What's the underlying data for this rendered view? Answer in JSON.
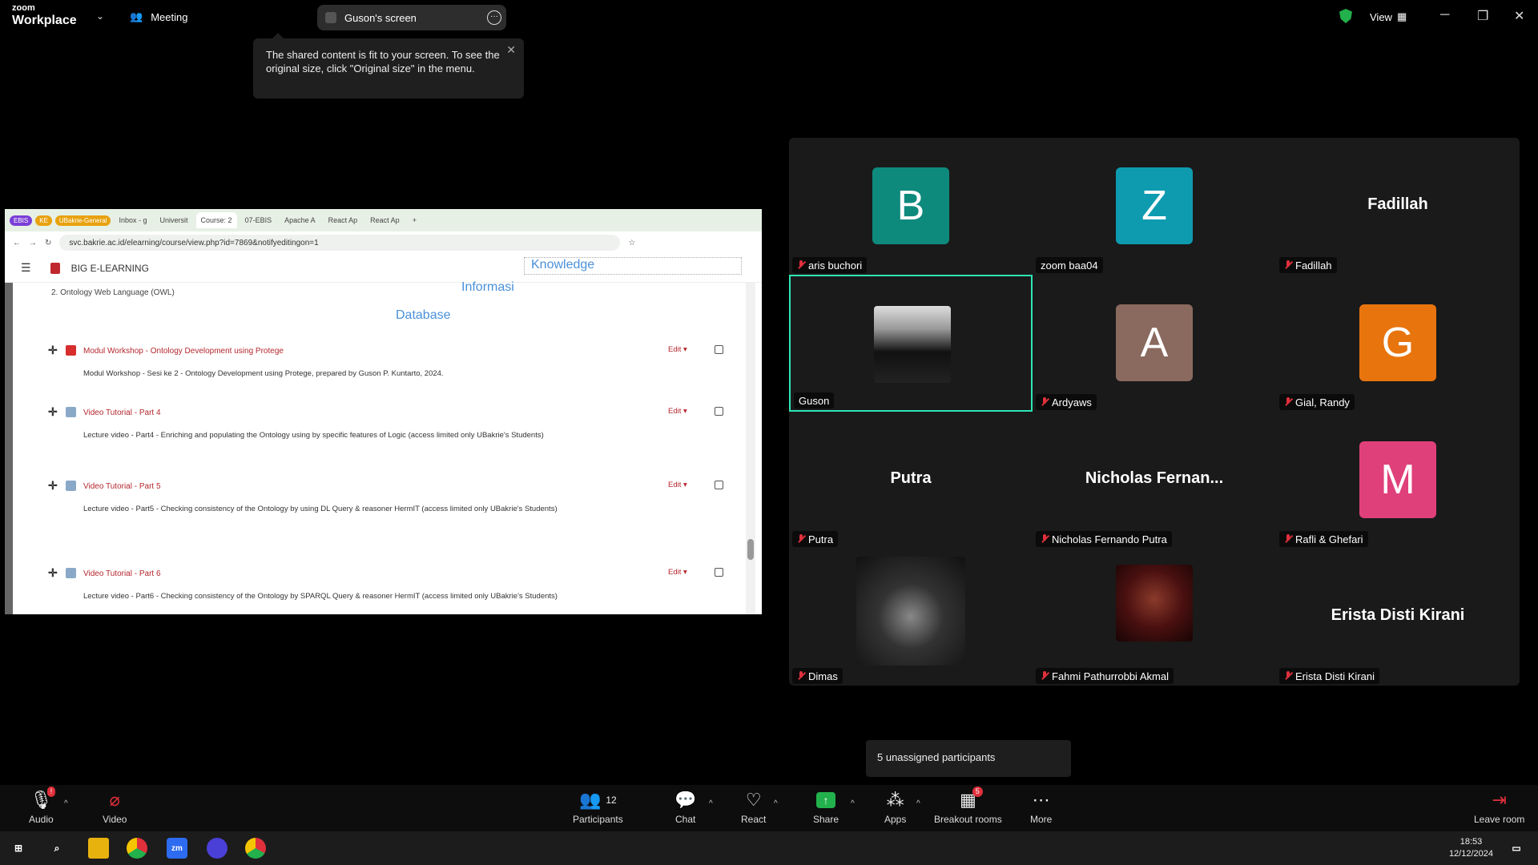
{
  "app": {
    "brand_top": "zoom",
    "brand_bottom": "Workplace",
    "meeting_label": "Meeting",
    "share_pill": "Guson's screen",
    "view_label": "View"
  },
  "tooltip": {
    "text": "The shared content is fit to your screen. To see the original size, click \"Original size\" in the menu."
  },
  "browser": {
    "tabs": [
      "EBIS",
      "KE",
      "UBakrie-General",
      "Inbox - g",
      "Universit",
      "Course: 2",
      "07-EBIS",
      "Apache A",
      "React Ap",
      "React Ap"
    ],
    "url": "svc.bakrie.ac.id/elearning/course/view.php?id=7869&notifyeditingon=1"
  },
  "moodle": {
    "site_title": "BIG E-LEARNING",
    "logo_text": "BAKRIE",
    "knowledge": "Knowledge",
    "informasi": "Informasi",
    "database": "Database",
    "owl_item": "2. Ontology Web Language (OWL)",
    "edit_label": "Edit ▾",
    "activities": [
      {
        "title": "Modul Workshop - Ontology Development using Protege",
        "desc": "Modul Workshop - Sesi ke 2 - Ontology Development using Protege, prepared by Guson P. Kuntarto, 2024."
      },
      {
        "title": "Video Tutorial - Part 4",
        "desc": "Lecture video - Part4 - Enriching and populating the Ontology using by specific features of Logic (access limited only UBakrie's Students)"
      },
      {
        "title": "Video Tutorial - Part 5",
        "desc": "Lecture video - Part5 - Checking consistency of the Ontology by using DL Query & reasoner HermIT (access limited only UBakrie's Students)"
      },
      {
        "title": "Video Tutorial - Part 6",
        "desc": "Lecture video - Part6 - Checking consistency of the Ontology by SPARQL Query & reasoner HermIT (access limited only UBakrie's Students)"
      }
    ]
  },
  "participants_grid": [
    {
      "letter": "B",
      "name": "aris buchori",
      "color": "#0e8a7d",
      "muted": true
    },
    {
      "letter": "Z",
      "name": "zoom baa04",
      "color": "#0e9bb0",
      "muted": false
    },
    {
      "big": "Fadillah",
      "name": "Fadillah",
      "muted": true
    },
    {
      "photo": true,
      "name": "Guson",
      "muted": false,
      "active": true
    },
    {
      "letter": "A",
      "name": "Ardyaws",
      "color": "#8a6a5e",
      "muted": true
    },
    {
      "letter": "G",
      "name": "Gial, Randy",
      "color": "#e8740e",
      "muted": true
    },
    {
      "big": "Putra",
      "name": "Putra",
      "muted": true
    },
    {
      "big": "Nicholas  Fernan...",
      "name": "Nicholas Fernando Putra",
      "muted": true
    },
    {
      "letter": "M",
      "name": "Rafli & Ghefari",
      "color": "#e0407a",
      "muted": true
    },
    {
      "photo": true,
      "name": "Dimas",
      "muted": true
    },
    {
      "photo": true,
      "name": "Fahmi Pathurrobbi Akmal",
      "muted": true
    },
    {
      "big": "Erista Disti Kirani",
      "name": "Erista Disti Kirani",
      "muted": true
    }
  ],
  "unassigned": "5 unassigned participants",
  "toolbar": {
    "audio": "Audio",
    "video": "Video",
    "participants": "Participants",
    "participants_count": "12",
    "chat": "Chat",
    "react": "React",
    "share": "Share",
    "apps": "Apps",
    "breakout": "Breakout rooms",
    "breakout_badge": "5",
    "more": "More",
    "leave": "Leave room"
  },
  "taskbar": {
    "time": "18:53",
    "date": "12/12/2024"
  }
}
